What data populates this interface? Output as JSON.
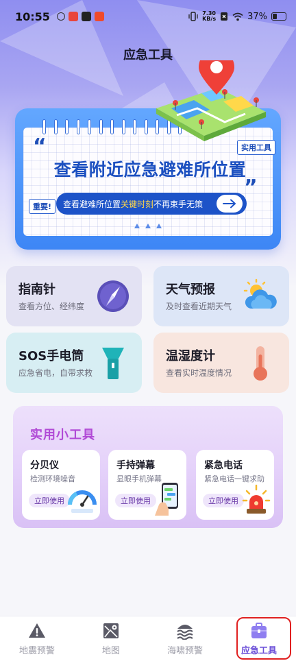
{
  "status_bar": {
    "time": "10:55",
    "network_speed_value": "7.30",
    "network_speed_unit": "KB/s",
    "battery": "37%",
    "battery_level": 0.37
  },
  "page": {
    "title": "应急工具"
  },
  "banner": {
    "headline": "查看附近应急避难所位置",
    "tag_tool": "实用工具",
    "tag_important": "重要!",
    "pill_text_before": "查看避难所位置",
    "pill_text_highlight": "关键时刻",
    "pill_text_after": "不再束手无策"
  },
  "cards": {
    "compass": {
      "title": "指南针",
      "subtitle": "查看方位、经纬度",
      "icon": "compass-icon"
    },
    "weather": {
      "title": "天气预报",
      "subtitle": "及时查看近期天气",
      "icon": "weather-icon"
    },
    "sos": {
      "title": "SOS手电筒",
      "subtitle": "应急省电，自带求救",
      "icon": "flashlight-icon"
    },
    "thermo": {
      "title": "温湿度计",
      "subtitle": "查看实时温度情况",
      "icon": "thermometer-icon"
    }
  },
  "tools": {
    "title": "实用小工具",
    "items": [
      {
        "title": "分贝仪",
        "subtitle": "检测环境噪音",
        "button": "立即使用",
        "icon": "decibel-meter-icon"
      },
      {
        "title": "手持弹幕",
        "subtitle": "显眼手机弹幕",
        "button": "立即使用",
        "icon": "phone-hand-icon"
      },
      {
        "title": "紧急电话",
        "subtitle": "紧急电话一键求助",
        "button": "立即使用",
        "icon": "alarm-siren-icon"
      }
    ]
  },
  "bottom_nav": {
    "items": [
      {
        "label": "地震预警",
        "icon": "warning-triangle-icon",
        "active": false
      },
      {
        "label": "地图",
        "icon": "map-icon",
        "active": false
      },
      {
        "label": "海啸预警",
        "icon": "tsunami-icon",
        "active": false
      },
      {
        "label": "应急工具",
        "icon": "toolbox-icon",
        "active": true
      }
    ]
  },
  "colors": {
    "accent": "#6b4fd8",
    "banner_blue": "#1d53c8",
    "highlight_yellow": "#ffd74a",
    "tools_title": "#b14ad6",
    "nav_highlight_border": "#e02020"
  }
}
